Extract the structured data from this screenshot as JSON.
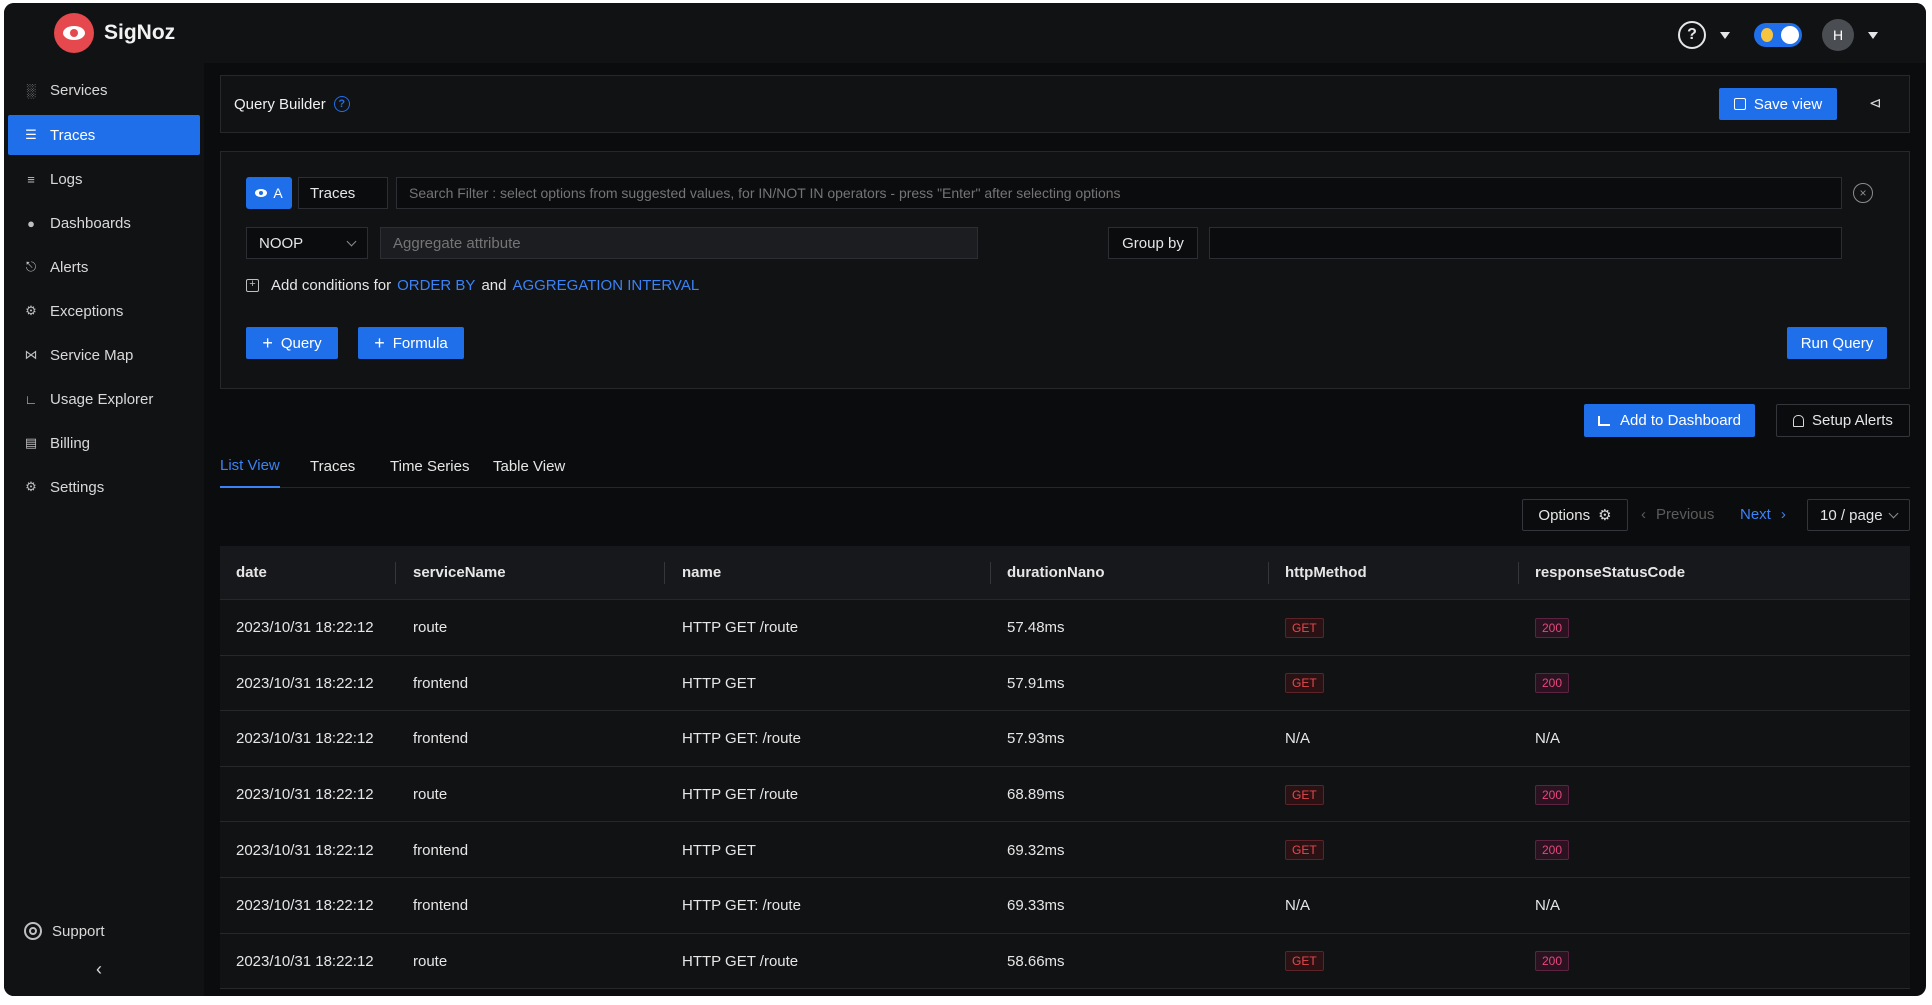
{
  "app": {
    "name": "SigNoz",
    "user_initial": "H"
  },
  "sidebar": {
    "items": [
      {
        "label": "Services",
        "icon": "bar-chart-icon"
      },
      {
        "label": "Traces",
        "icon": "list-icon",
        "active": true
      },
      {
        "label": "Logs",
        "icon": "align-left-icon"
      },
      {
        "label": "Dashboards",
        "icon": "dashboard-icon"
      },
      {
        "label": "Alerts",
        "icon": "bell-icon"
      },
      {
        "label": "Exceptions",
        "icon": "bug-icon"
      },
      {
        "label": "Service Map",
        "icon": "network-icon"
      },
      {
        "label": "Usage Explorer",
        "icon": "line-chart-icon"
      },
      {
        "label": "Billing",
        "icon": "receipt-icon"
      },
      {
        "label": "Settings",
        "icon": "gear-icon"
      }
    ],
    "support": "Support"
  },
  "query_builder": {
    "title": "Query Builder",
    "save_view": "Save view",
    "query_tag": "A",
    "data_source": "Traces",
    "search_placeholder": "Search Filter : select options from suggested values, for IN/NOT IN operators - press \"Enter\" after selecting options",
    "aggregate_operator": "NOOP",
    "aggregate_attr_placeholder": "Aggregate attribute",
    "group_by": "Group by",
    "conditions_prefix": "Add conditions for",
    "conditions_order_by": "ORDER BY",
    "conditions_and": "and",
    "conditions_interval": "AGGREGATION INTERVAL",
    "add_query": "Query",
    "add_formula": "Formula",
    "run_query": "Run Query"
  },
  "actions": {
    "add_to_dashboard": "Add to Dashboard",
    "setup_alerts": "Setup Alerts"
  },
  "tabs": [
    "List View",
    "Traces",
    "Time Series",
    "Table View"
  ],
  "pagination": {
    "options": "Options",
    "previous": "Previous",
    "next": "Next",
    "page_size": "10 / page"
  },
  "table": {
    "columns": [
      "date",
      "serviceName",
      "name",
      "durationNano",
      "httpMethod",
      "responseStatusCode"
    ],
    "rows": [
      {
        "date": "2023/10/31 18:22:12",
        "serviceName": "route",
        "name": "HTTP GET /route",
        "durationNano": "57.48ms",
        "httpMethod": "GET",
        "responseStatusCode": "200"
      },
      {
        "date": "2023/10/31 18:22:12",
        "serviceName": "frontend",
        "name": "HTTP GET",
        "durationNano": "57.91ms",
        "httpMethod": "GET",
        "responseStatusCode": "200"
      },
      {
        "date": "2023/10/31 18:22:12",
        "serviceName": "frontend",
        "name": "HTTP GET: /route",
        "durationNano": "57.93ms",
        "httpMethod": "N/A",
        "responseStatusCode": "N/A"
      },
      {
        "date": "2023/10/31 18:22:12",
        "serviceName": "route",
        "name": "HTTP GET /route",
        "durationNano": "68.89ms",
        "httpMethod": "GET",
        "responseStatusCode": "200"
      },
      {
        "date": "2023/10/31 18:22:12",
        "serviceName": "frontend",
        "name": "HTTP GET",
        "durationNano": "69.32ms",
        "httpMethod": "GET",
        "responseStatusCode": "200"
      },
      {
        "date": "2023/10/31 18:22:12",
        "serviceName": "frontend",
        "name": "HTTP GET: /route",
        "durationNano": "69.33ms",
        "httpMethod": "N/A",
        "responseStatusCode": "N/A"
      },
      {
        "date": "2023/10/31 18:22:12",
        "serviceName": "route",
        "name": "HTTP GET /route",
        "durationNano": "58.66ms",
        "httpMethod": "GET",
        "responseStatusCode": "200"
      }
    ]
  },
  "colors": {
    "accent": "#1f6feb",
    "background": "#0b0c0e",
    "method_tag": "#e5484d",
    "status_tag": "#e5487d"
  }
}
